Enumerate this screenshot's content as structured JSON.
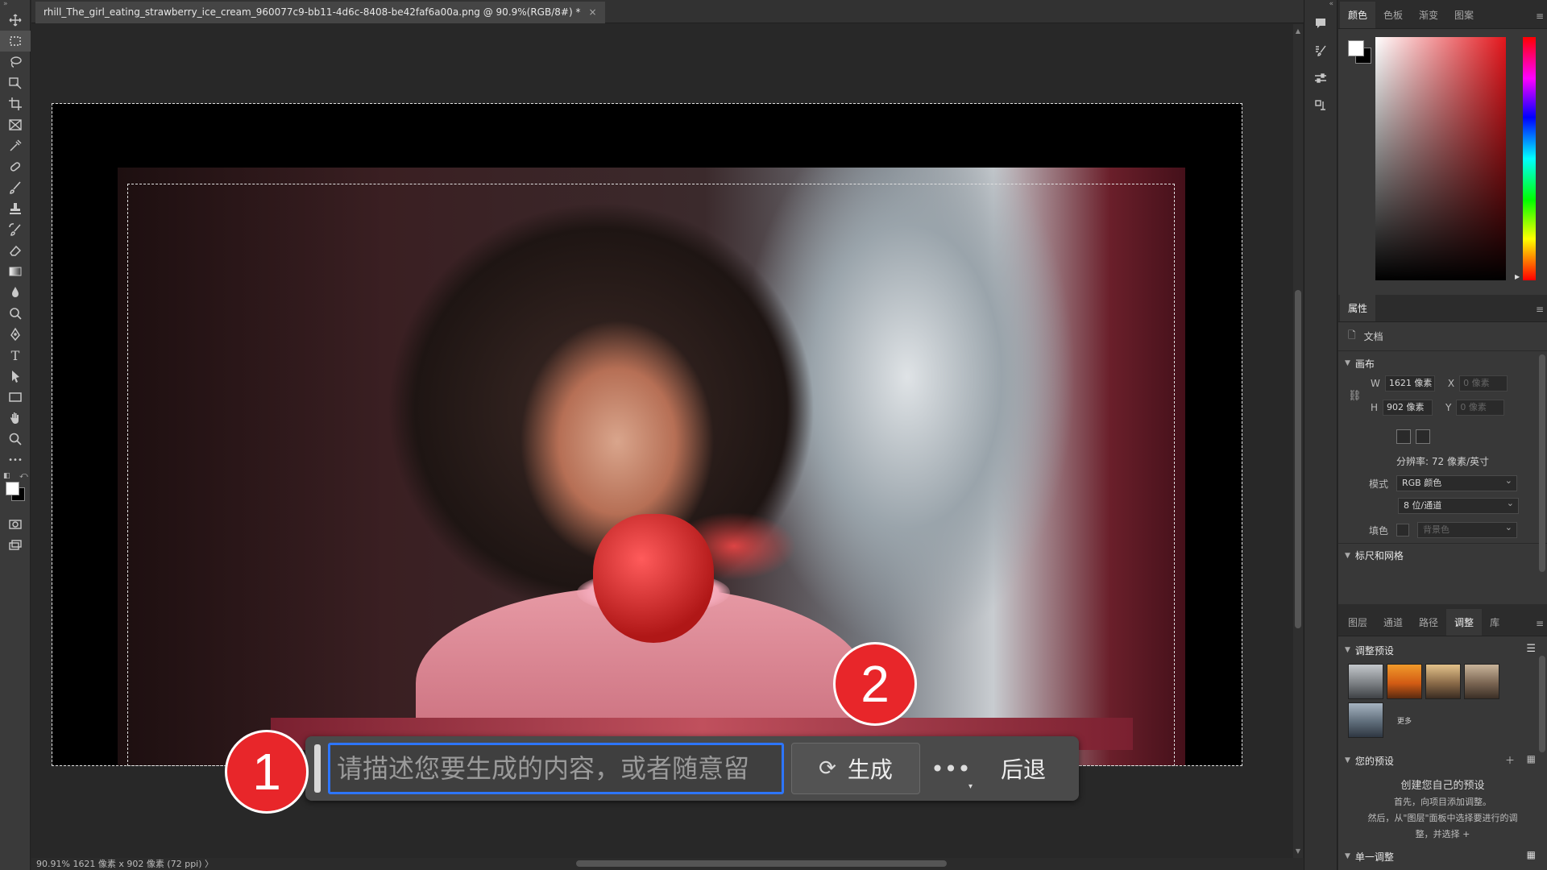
{
  "document": {
    "tab_title": "rhill_The_girl_eating_strawberry_ice_cream_960077c9-bb11-4d6c-8408-be42faf6a00a.png @ 90.9%(RGB/8#) *",
    "tab_close": "×"
  },
  "toolbar": {
    "collapse": "»",
    "tools": [
      "move-tool",
      "rect-marquee-tool",
      "lasso-tool",
      "object-select-tool",
      "crop-tool",
      "frame-tool",
      "eyedropper-tool",
      "spot-heal-tool",
      "brush-tool",
      "clone-stamp-tool",
      "history-brush-tool",
      "eraser-tool",
      "gradient-tool",
      "blur-tool",
      "dodge-tool",
      "pen-tool",
      "type-tool",
      "path-select-tool",
      "rectangle-tool",
      "hand-tool",
      "zoom-tool",
      "more-tools"
    ],
    "active_tool": "rect-marquee-tool",
    "type_glyph": "T",
    "more_glyph": "•••"
  },
  "taskbar": {
    "prompt_placeholder": "请描述您要生成的内容，或者随意留",
    "generate_label": "生成",
    "more_label": "•••",
    "undo_label": "后退"
  },
  "annotations": {
    "badge1": "1",
    "badge2": "2"
  },
  "status": {
    "text": "90.91%  1621 像素 x 902 像素 (72 ppi)   〉"
  },
  "iconcol": {
    "collapse": "«"
  },
  "panels": {
    "collapse": "«",
    "color_tabs": [
      "颜色",
      "色板",
      "渐变",
      "图案"
    ],
    "properties": {
      "tab": "属性",
      "doc_label": "文档",
      "canvas_head": "画布",
      "w_label": "W",
      "w_value": "1621 像素",
      "h_label": "H",
      "h_value": "902 像素",
      "x_label": "X",
      "x_value": "0 像素",
      "y_label": "Y",
      "y_value": "0 像素",
      "resolution": "分辨率: 72 像素/英寸",
      "mode_label": "模式",
      "mode_value": "RGB 颜色",
      "depth_value": "8 位/通道",
      "fill_label": "填色",
      "fill_value": "背景色",
      "rulers_head": "标尺和网格"
    },
    "bottom_tabs": [
      "图层",
      "通道",
      "路径",
      "调整",
      "库"
    ],
    "adjust": {
      "presets_head": "调整预设",
      "more_label": "更多",
      "yours_head": "您的预设",
      "create_title": "创建您自己的预设",
      "create_line1": "首先，向项目添加调整。",
      "create_line2": "然后，从\"图层\"面板中选择要进行的调",
      "create_line3": "整，并选择 +",
      "single_head": "单一调整"
    }
  },
  "colors": {
    "accent": "#2d76ff",
    "badge": "#e8262a"
  }
}
